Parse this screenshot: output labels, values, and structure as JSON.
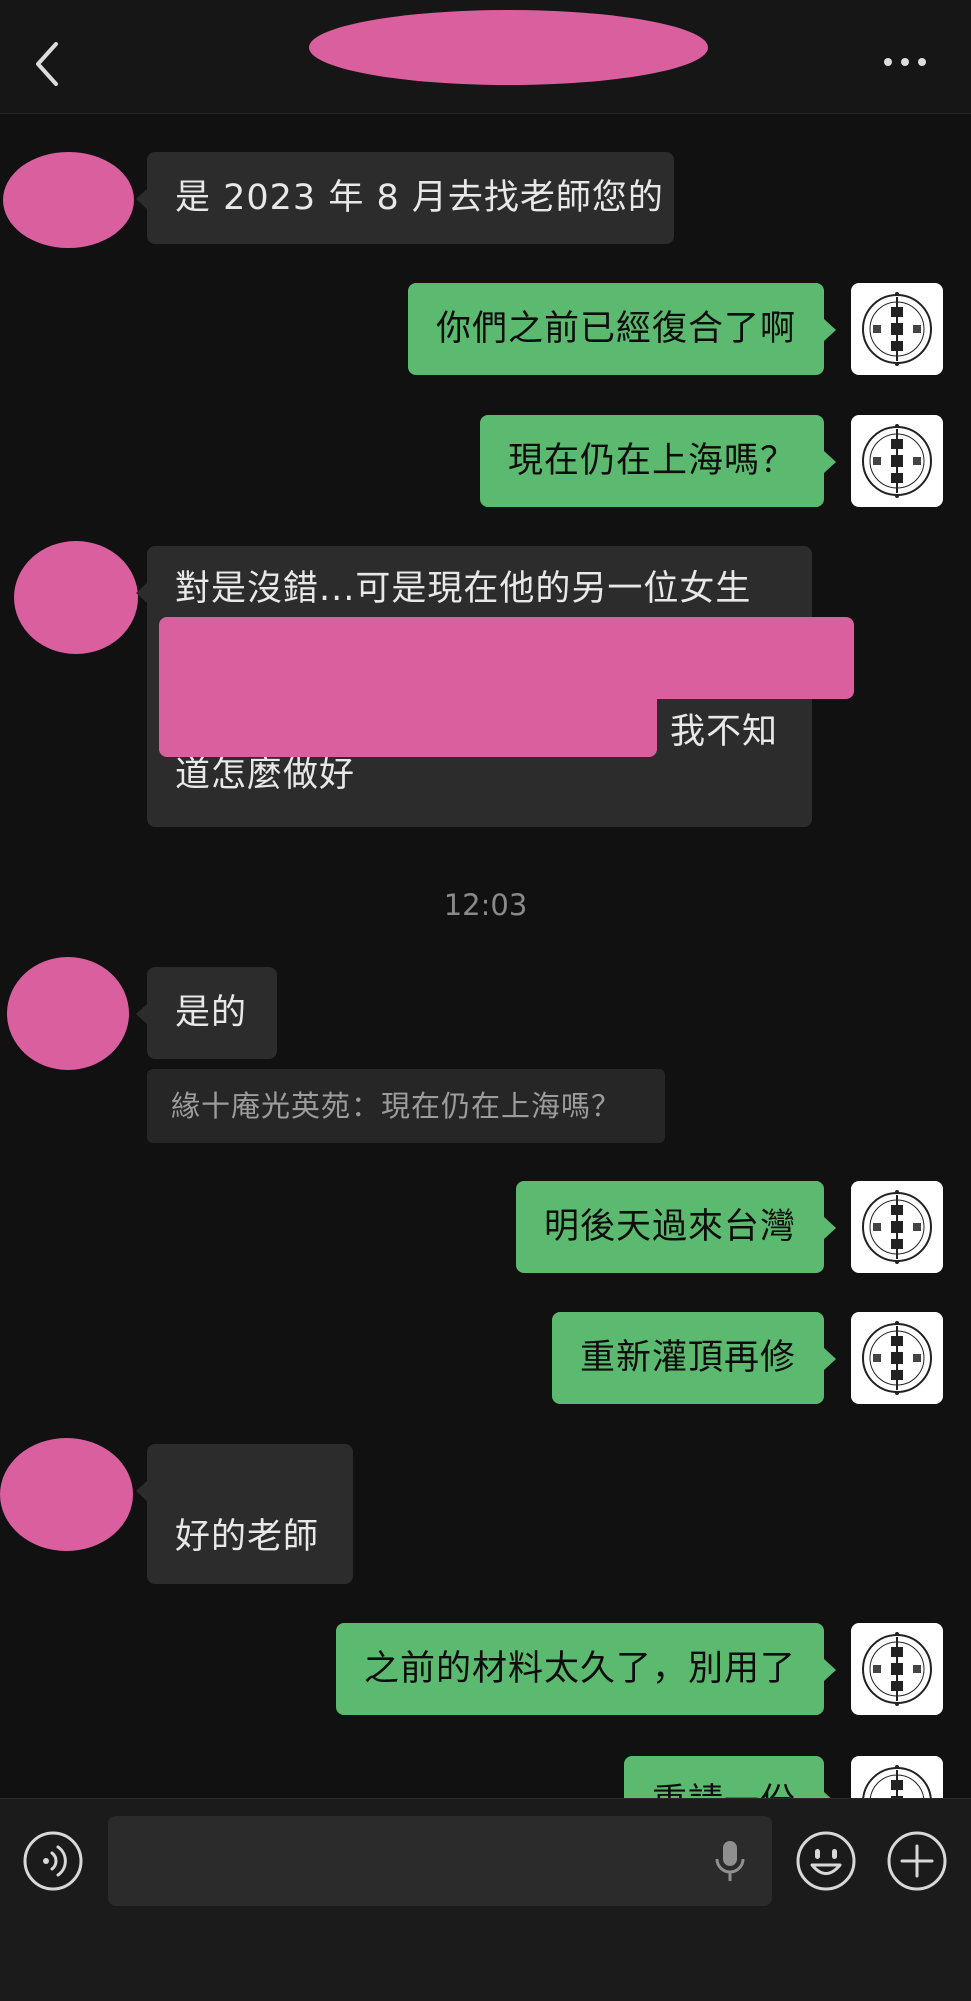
{
  "header": {
    "back_icon": "chevron-left-icon",
    "more_icon": "more-horizontal-icon"
  },
  "messages": [
    {
      "side": "in",
      "text": "是 2023 年 8 月去找老師您的"
    },
    {
      "side": "out",
      "text": "你們之前已經復合了啊"
    },
    {
      "side": "out",
      "text": "現在仍在上海嗎？"
    },
    {
      "side": "in",
      "line1": "對是沒錯...可是現在他的另一位女生",
      "line3_visible": "我不知",
      "line4": "道怎麼做好"
    },
    {
      "side": "in",
      "text": "是的",
      "quote": "緣十庵光英苑：現在仍在上海嗎？"
    },
    {
      "side": "out",
      "text": "明後天過來台灣"
    },
    {
      "side": "out",
      "text": "重新灌頂再修"
    },
    {
      "side": "in",
      "text": "好的老師"
    },
    {
      "side": "out",
      "text": "之前的材料太久了，別用了"
    },
    {
      "side": "out",
      "text": "重請一份"
    }
  ],
  "timestamp": "12:03",
  "colors": {
    "background": "#111111",
    "incoming_bubble": "#2c2c2c",
    "outgoing_bubble": "#5bba6f",
    "redaction": "#d95f9f"
  },
  "input_bar": {
    "voice_icon": "voice-mode-icon",
    "mic_icon": "microphone-icon",
    "emoji_icon": "emoji-icon",
    "plus_icon": "plus-circle-icon"
  }
}
